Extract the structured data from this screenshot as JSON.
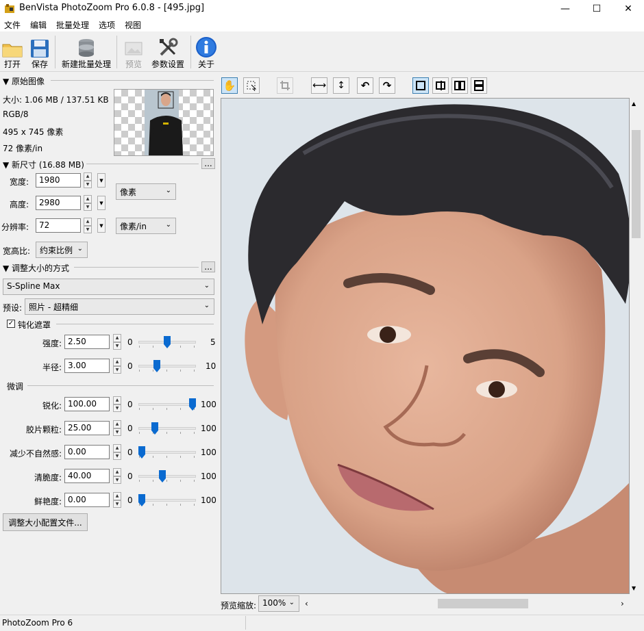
{
  "window": {
    "title": "BenVista PhotoZoom Pro 6.0.8 - [495.jpg]",
    "minimize": "—",
    "maximize": "☐",
    "close": "✕"
  },
  "menu": [
    "文件",
    "编辑",
    "批量处理",
    "选项",
    "视图"
  ],
  "toolbar": {
    "open": "打开",
    "save": "保存",
    "new_batch": "新建批量处理",
    "preview": "预览",
    "settings": "参数设置",
    "about": "关于"
  },
  "original": {
    "title": "▼ 原始图像",
    "size": "大小: 1.06 MB / 137.51 KB",
    "mode": "RGB/8",
    "dimensions": "495 x 745 像素",
    "resolution": "72 像素/in"
  },
  "new_size": {
    "title": "▼ 新尺寸 (16.88 MB)",
    "more": "...",
    "width_label": "宽度:",
    "width_value": "1980",
    "height_label": "高度:",
    "height_value": "2980",
    "res_label": "分辨率:",
    "res_value": "72",
    "unit_size": "像素",
    "unit_res": "像素/in",
    "aspect_label": "宽高比:",
    "aspect_value": "约束比例"
  },
  "method": {
    "title": "▼ 调整大小的方式",
    "more": "...",
    "algorithm": "S-Spline Max",
    "preset_label": "预设:",
    "preset_value": "照片 - 超精细"
  },
  "unsharp": {
    "title": "钝化遮罩",
    "checked": true,
    "rows": [
      {
        "label": "强度:",
        "value": "2.50",
        "min": "0",
        "max": "5",
        "fraction": 0.5
      },
      {
        "label": "半径:",
        "value": "3.00",
        "min": "0",
        "max": "10",
        "fraction": 0.3
      }
    ]
  },
  "fine_tune": {
    "title": "微调",
    "rows": [
      {
        "label": "锐化:",
        "value": "100.00",
        "min": "0",
        "max": "100",
        "fraction": 1.0
      },
      {
        "label": "胶片颗粒:",
        "value": "25.00",
        "min": "0",
        "max": "100",
        "fraction": 0.25
      },
      {
        "label": "减少不自然感:",
        "value": "0.00",
        "min": "0",
        "max": "100",
        "fraction": 0.0
      },
      {
        "label": "清脆度:",
        "value": "40.00",
        "min": "0",
        "max": "100",
        "fraction": 0.4
      },
      {
        "label": "鲜艳度:",
        "value": "0.00",
        "min": "0",
        "max": "100",
        "fraction": 0.0
      }
    ]
  },
  "profile_button": "调整大小配置文件...",
  "preview": {
    "zoom_label": "预览缩放:",
    "zoom_value": "100%"
  },
  "status": "PhotoZoom Pro 6",
  "colors": {
    "accent": "#1a73c8",
    "thumb": "#0a6ad0"
  }
}
